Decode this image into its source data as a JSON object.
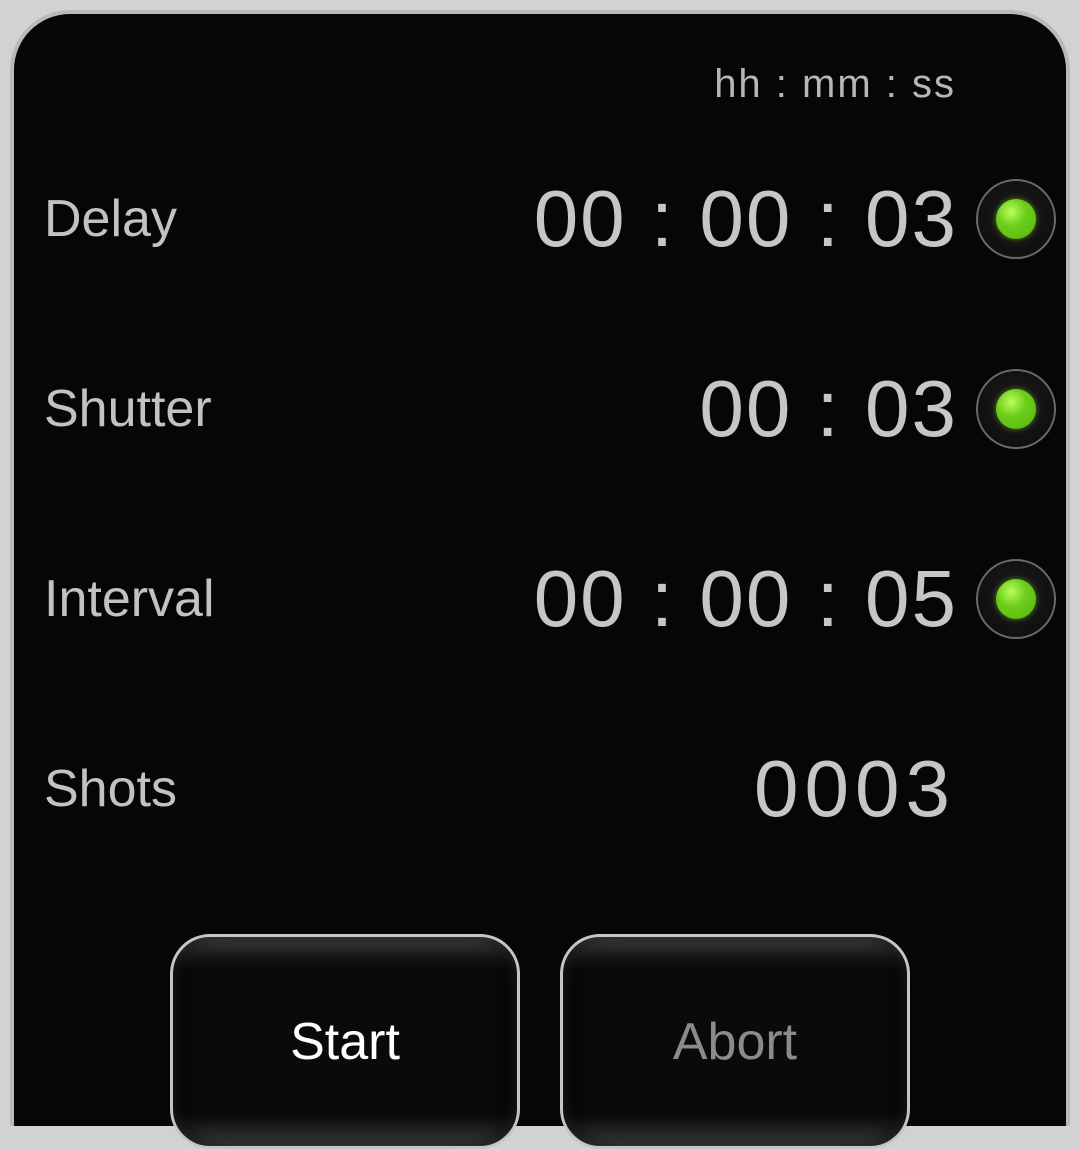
{
  "header": {
    "units": "hh   :   mm  :   ss"
  },
  "rows": {
    "delay": {
      "label": "Delay",
      "value": "00 : 00 : 03",
      "indicator": "active"
    },
    "shutter": {
      "label": "Shutter",
      "value": "00 : 03",
      "indicator": "active"
    },
    "interval": {
      "label": "Interval",
      "value": "00 : 00 : 05",
      "indicator": "active"
    },
    "shots": {
      "label": "Shots",
      "value": "0003"
    }
  },
  "buttons": {
    "start": "Start",
    "abort": "Abort"
  },
  "colors": {
    "indicator_green": "#6dcd1b"
  }
}
